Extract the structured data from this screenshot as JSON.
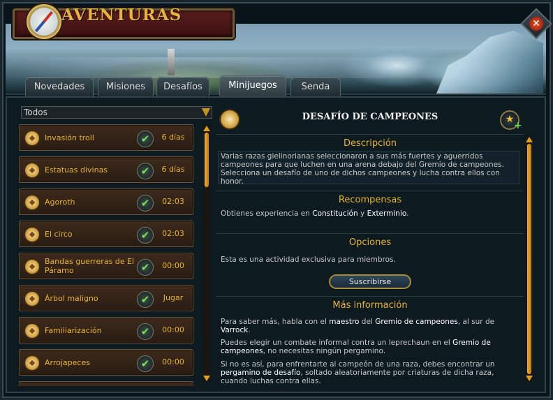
{
  "window": {
    "title": "AVENTURAS",
    "close_label": "✕"
  },
  "tabs": [
    {
      "label": "Novedades",
      "active": false
    },
    {
      "label": "Misiones",
      "active": false
    },
    {
      "label": "Desafíos",
      "active": false
    },
    {
      "label": "Minijuegos",
      "active": true
    },
    {
      "label": "Senda",
      "active": false
    }
  ],
  "filter": {
    "selected": "Todos"
  },
  "activities": [
    {
      "name": "Invasión troll",
      "status": "6 días"
    },
    {
      "name": "Estatuas divinas",
      "status": "6 días"
    },
    {
      "name": "Agoroth",
      "status": "02:03"
    },
    {
      "name": "El circo",
      "status": "02:03"
    },
    {
      "name": "Bandas guerreras de El Páramo",
      "status": "00:00"
    },
    {
      "name": "Árbol maligno",
      "status": "Jugar"
    },
    {
      "name": "Familiarización",
      "status": "00:00"
    },
    {
      "name": "Arrojapeces",
      "status": "00:00"
    }
  ],
  "detail": {
    "title": "DESAFÍO DE CAMPEONES",
    "description": {
      "heading": "Descripción",
      "text": "Varias razas gielinorianas seleccionaron a sus más fuertes y aguerridos campeones para que luchen en una arena debajo del Gremio de campeones. Selecciona un desafío de uno de dichos campeones y lucha contra ellos con honor."
    },
    "rewards": {
      "heading": "Recompensas",
      "text_before": "Obtienes experiencia en ",
      "skill1": "Constitución",
      "and": " y ",
      "skill2": "Exterminio",
      "period": "."
    },
    "options": {
      "heading": "Opciones",
      "text": "Esta es una actividad exclusiva para miembros.",
      "button": "Suscribirse"
    },
    "more_info": {
      "heading": "Más información",
      "p1_a": "Para saber más, habla con el ",
      "p1_b": "maestro",
      "p1_c": " del ",
      "p1_d": "Gremio de campeones",
      "p1_e": ", al sur de ",
      "p1_f": "Varrock",
      "p1_g": ".",
      "p2_a": "Puedes elegir un combate informal contra un leprechaun en el ",
      "p2_b": "Gremio de campeones",
      "p2_c": ", no necesitas ningún pergamino.",
      "p3_a": "Si no es así, para enfrentarte al campeón de una raza, debes encontrar un ",
      "p3_b": "pergamino de desafío",
      "p3_c": ", soltado aleatoriamente por criaturas de dicha raza, cuando luchas contra ellas."
    }
  },
  "icons": {
    "compass": "compass-icon",
    "activity": "minigame-medallion-icon",
    "check": "checkmark-icon",
    "favorite": "star-plus-icon"
  },
  "colors": {
    "accent_gold": "#e8b430",
    "title_plate": "#5b1e1e",
    "check_green": "#6ee05a"
  }
}
